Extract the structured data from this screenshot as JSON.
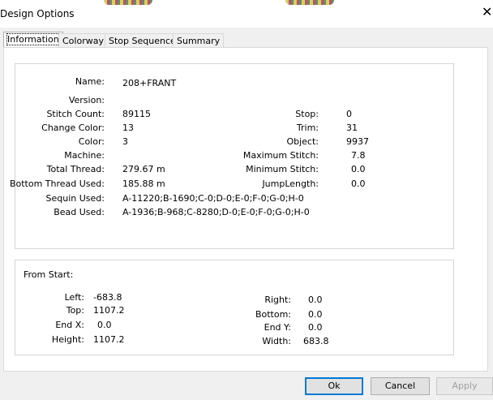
{
  "window": {
    "title": "Design Options",
    "close_glyph": "✕"
  },
  "tabs": [
    "Information",
    "Colorway",
    "Stop Sequence",
    "Summary"
  ],
  "info": {
    "name": {
      "label": "Name:",
      "value": "208+FRANT"
    },
    "version": {
      "label": "Version:",
      "value": ""
    },
    "stitch_count": {
      "label": "Stitch Count:",
      "value": "89115"
    },
    "change_color": {
      "label": "Change Color:",
      "value": "13"
    },
    "color": {
      "label": "Color:",
      "value": "3"
    },
    "machine": {
      "label": "Machine:",
      "value": ""
    },
    "total_thread": {
      "label": "Total Thread:",
      "value": "279.67 m"
    },
    "bottom_thread_used": {
      "label": "Bottom Thread Used:",
      "value": "185.88 m"
    },
    "sequin_used": {
      "label": "Sequin Used:",
      "value": "A-11220;B-1690;C-0;D-0;E-0;F-0;G-0;H-0"
    },
    "bead_used": {
      "label": "Bead Used:",
      "value": "A-1936;B-968;C-8280;D-0;E-0;F-0;G-0;H-0"
    },
    "stop": {
      "label": "Stop:",
      "value": "0"
    },
    "trim": {
      "label": "Trim:",
      "value": "31"
    },
    "object": {
      "label": "Object:",
      "value": "9937"
    },
    "maximum_stitch": {
      "label": "Maximum Stitch:",
      "value": "7.8"
    },
    "minimum_stitch": {
      "label": "Minimum Stitch:",
      "value": "0.0"
    },
    "jump_length": {
      "label": "JumpLength:",
      "value": "0.0"
    }
  },
  "from_start": {
    "heading": "From Start:",
    "left": {
      "label": "Left:",
      "value": "-683.8"
    },
    "top": {
      "label": "Top:",
      "value": "1107.2"
    },
    "end_x": {
      "label": "End X:",
      "value": "0.0"
    },
    "height": {
      "label": "Height:",
      "value": "1107.2"
    },
    "right": {
      "label": "Right:",
      "value": "0.0"
    },
    "bottom": {
      "label": "Bottom:",
      "value": "0.0"
    },
    "end_y": {
      "label": "End Y:",
      "value": "0.0"
    },
    "width": {
      "label": "Width:",
      "value": "683.8"
    }
  },
  "buttons": {
    "ok": "Ok",
    "cancel": "Cancel",
    "apply": "Apply"
  }
}
